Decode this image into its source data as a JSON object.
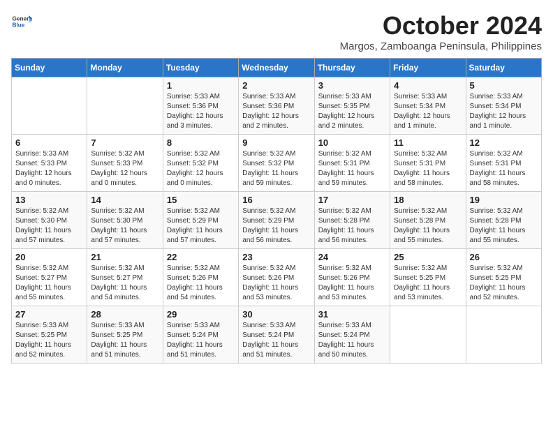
{
  "logo": {
    "general": "General",
    "blue": "Blue"
  },
  "title": "October 2024",
  "location": "Margos, Zamboanga Peninsula, Philippines",
  "days_header": [
    "Sunday",
    "Monday",
    "Tuesday",
    "Wednesday",
    "Thursday",
    "Friday",
    "Saturday"
  ],
  "weeks": [
    [
      {
        "day": "",
        "content": ""
      },
      {
        "day": "",
        "content": ""
      },
      {
        "day": "1",
        "content": "Sunrise: 5:33 AM\nSunset: 5:36 PM\nDaylight: 12 hours\nand 3 minutes."
      },
      {
        "day": "2",
        "content": "Sunrise: 5:33 AM\nSunset: 5:36 PM\nDaylight: 12 hours\nand 2 minutes."
      },
      {
        "day": "3",
        "content": "Sunrise: 5:33 AM\nSunset: 5:35 PM\nDaylight: 12 hours\nand 2 minutes."
      },
      {
        "day": "4",
        "content": "Sunrise: 5:33 AM\nSunset: 5:34 PM\nDaylight: 12 hours\nand 1 minute."
      },
      {
        "day": "5",
        "content": "Sunrise: 5:33 AM\nSunset: 5:34 PM\nDaylight: 12 hours\nand 1 minute."
      }
    ],
    [
      {
        "day": "6",
        "content": "Sunrise: 5:33 AM\nSunset: 5:33 PM\nDaylight: 12 hours\nand 0 minutes."
      },
      {
        "day": "7",
        "content": "Sunrise: 5:32 AM\nSunset: 5:33 PM\nDaylight: 12 hours\nand 0 minutes."
      },
      {
        "day": "8",
        "content": "Sunrise: 5:32 AM\nSunset: 5:32 PM\nDaylight: 12 hours\nand 0 minutes."
      },
      {
        "day": "9",
        "content": "Sunrise: 5:32 AM\nSunset: 5:32 PM\nDaylight: 11 hours\nand 59 minutes."
      },
      {
        "day": "10",
        "content": "Sunrise: 5:32 AM\nSunset: 5:31 PM\nDaylight: 11 hours\nand 59 minutes."
      },
      {
        "day": "11",
        "content": "Sunrise: 5:32 AM\nSunset: 5:31 PM\nDaylight: 11 hours\nand 58 minutes."
      },
      {
        "day": "12",
        "content": "Sunrise: 5:32 AM\nSunset: 5:31 PM\nDaylight: 11 hours\nand 58 minutes."
      }
    ],
    [
      {
        "day": "13",
        "content": "Sunrise: 5:32 AM\nSunset: 5:30 PM\nDaylight: 11 hours\nand 57 minutes."
      },
      {
        "day": "14",
        "content": "Sunrise: 5:32 AM\nSunset: 5:30 PM\nDaylight: 11 hours\nand 57 minutes."
      },
      {
        "day": "15",
        "content": "Sunrise: 5:32 AM\nSunset: 5:29 PM\nDaylight: 11 hours\nand 57 minutes."
      },
      {
        "day": "16",
        "content": "Sunrise: 5:32 AM\nSunset: 5:29 PM\nDaylight: 11 hours\nand 56 minutes."
      },
      {
        "day": "17",
        "content": "Sunrise: 5:32 AM\nSunset: 5:28 PM\nDaylight: 11 hours\nand 56 minutes."
      },
      {
        "day": "18",
        "content": "Sunrise: 5:32 AM\nSunset: 5:28 PM\nDaylight: 11 hours\nand 55 minutes."
      },
      {
        "day": "19",
        "content": "Sunrise: 5:32 AM\nSunset: 5:28 PM\nDaylight: 11 hours\nand 55 minutes."
      }
    ],
    [
      {
        "day": "20",
        "content": "Sunrise: 5:32 AM\nSunset: 5:27 PM\nDaylight: 11 hours\nand 55 minutes."
      },
      {
        "day": "21",
        "content": "Sunrise: 5:32 AM\nSunset: 5:27 PM\nDaylight: 11 hours\nand 54 minutes."
      },
      {
        "day": "22",
        "content": "Sunrise: 5:32 AM\nSunset: 5:26 PM\nDaylight: 11 hours\nand 54 minutes."
      },
      {
        "day": "23",
        "content": "Sunrise: 5:32 AM\nSunset: 5:26 PM\nDaylight: 11 hours\nand 53 minutes."
      },
      {
        "day": "24",
        "content": "Sunrise: 5:32 AM\nSunset: 5:26 PM\nDaylight: 11 hours\nand 53 minutes."
      },
      {
        "day": "25",
        "content": "Sunrise: 5:32 AM\nSunset: 5:25 PM\nDaylight: 11 hours\nand 53 minutes."
      },
      {
        "day": "26",
        "content": "Sunrise: 5:32 AM\nSunset: 5:25 PM\nDaylight: 11 hours\nand 52 minutes."
      }
    ],
    [
      {
        "day": "27",
        "content": "Sunrise: 5:33 AM\nSunset: 5:25 PM\nDaylight: 11 hours\nand 52 minutes."
      },
      {
        "day": "28",
        "content": "Sunrise: 5:33 AM\nSunset: 5:25 PM\nDaylight: 11 hours\nand 51 minutes."
      },
      {
        "day": "29",
        "content": "Sunrise: 5:33 AM\nSunset: 5:24 PM\nDaylight: 11 hours\nand 51 minutes."
      },
      {
        "day": "30",
        "content": "Sunrise: 5:33 AM\nSunset: 5:24 PM\nDaylight: 11 hours\nand 51 minutes."
      },
      {
        "day": "31",
        "content": "Sunrise: 5:33 AM\nSunset: 5:24 PM\nDaylight: 11 hours\nand 50 minutes."
      },
      {
        "day": "",
        "content": ""
      },
      {
        "day": "",
        "content": ""
      }
    ]
  ]
}
